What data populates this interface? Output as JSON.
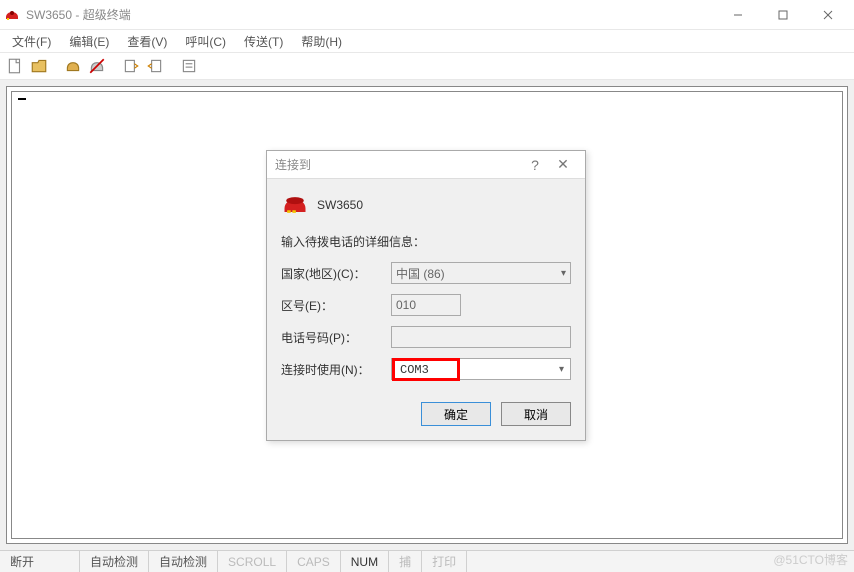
{
  "window": {
    "title": "SW3650 - 超级终端"
  },
  "menu": {
    "file": "文件(F)",
    "edit": "编辑(E)",
    "view": "查看(V)",
    "call": "呼叫(C)",
    "transfer": "传送(T)",
    "help": "帮助(H)"
  },
  "statusbar": {
    "disconnect": "断开",
    "autodetect1": "自动检测",
    "autodetect2": "自动检测",
    "scroll": "SCROLL",
    "caps": "CAPS",
    "num": "NUM",
    "capture": "捕",
    "print": "打印"
  },
  "dialog": {
    "title": "连接到",
    "connection_name": "SW3650",
    "instruction": "输入待拨电话的详细信息：",
    "country_label": "国家(地区)(C)：",
    "country_value": "中国 (86)",
    "area_label": "区号(E)：",
    "area_value": "010",
    "phone_label": "电话号码(P)：",
    "phone_value": "",
    "connect_label": "连接时使用(N)：",
    "connect_value": "COM3",
    "ok": "确定",
    "cancel": "取消"
  },
  "watermark": "@51CTO博客"
}
